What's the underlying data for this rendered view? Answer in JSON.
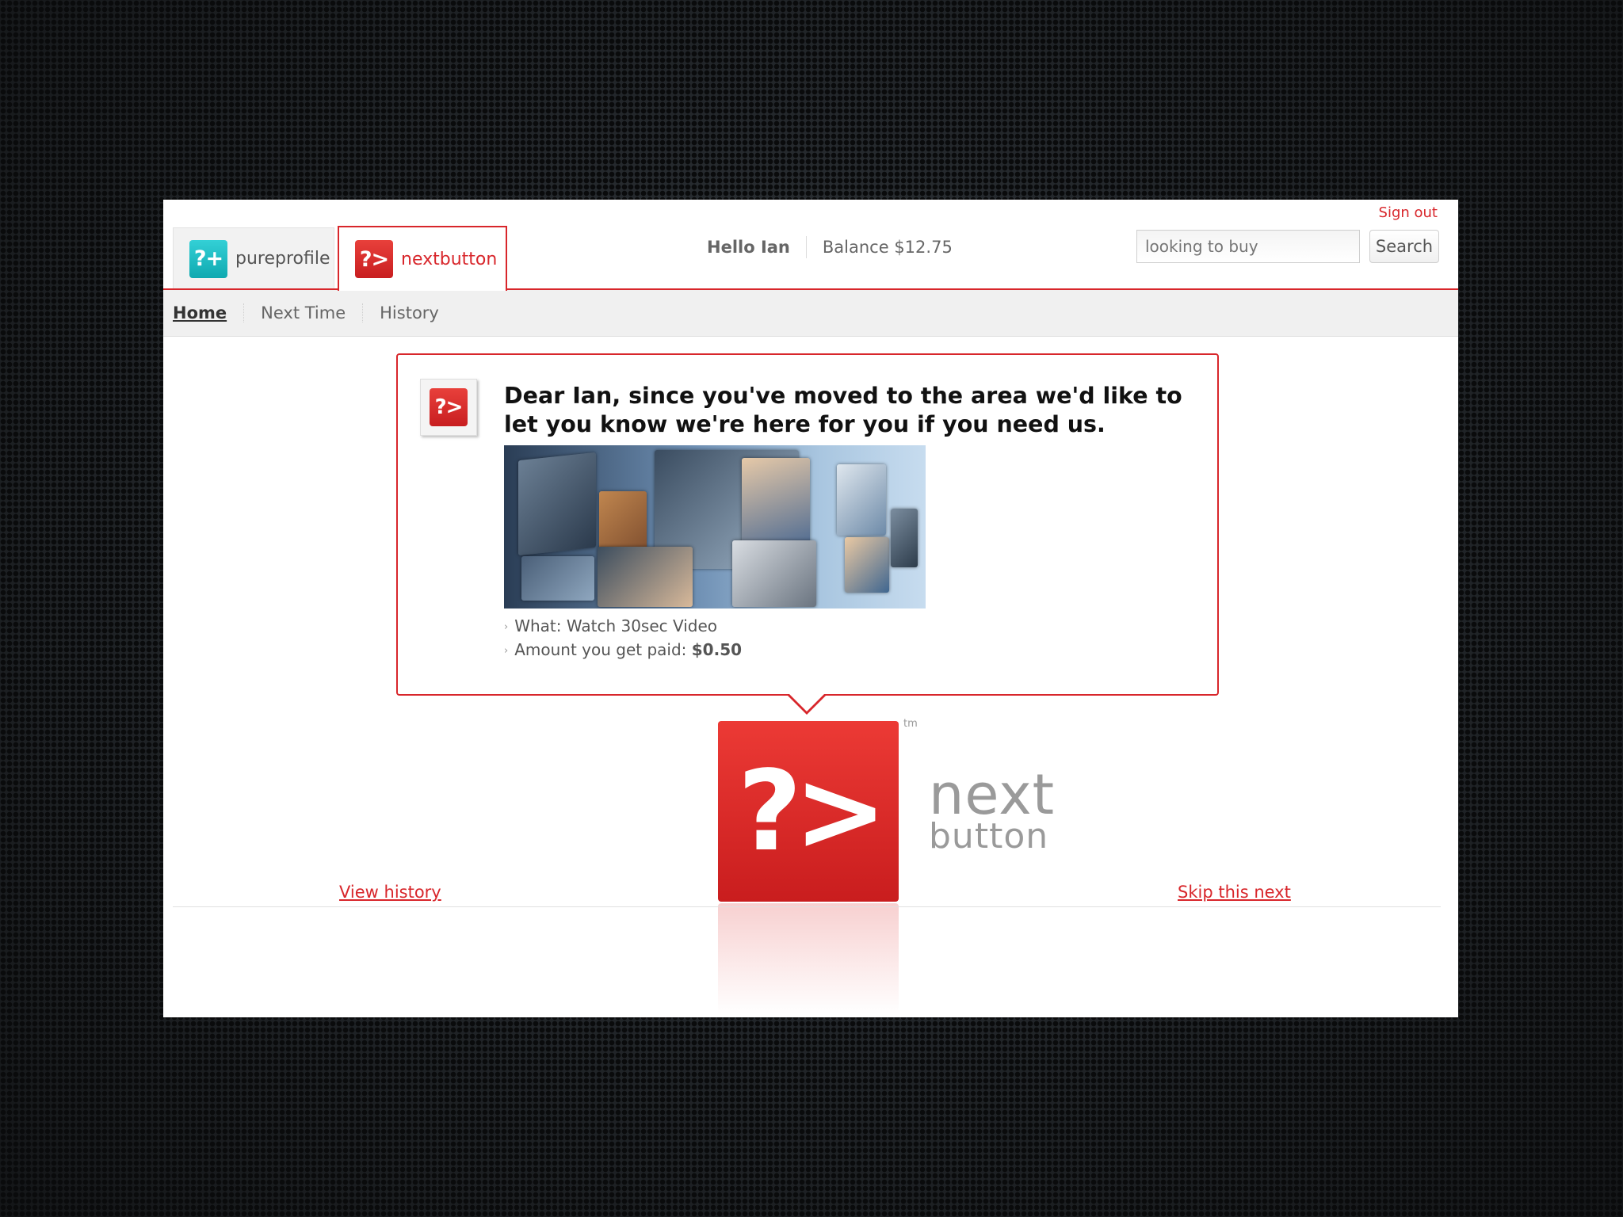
{
  "header": {
    "sign_out": "Sign out",
    "tabs": [
      {
        "label": "pureprofile",
        "icon_text": "?+",
        "icon": "pureprofile-logo-icon",
        "color": "#19b8bf",
        "active": false
      },
      {
        "label": "nextbutton",
        "icon_text": "?>",
        "icon": "nextbutton-logo-icon",
        "color": "#d8262b",
        "active": true
      }
    ],
    "greeting": "Hello Ian",
    "balance": "Balance $12.75",
    "search": {
      "placeholder": "looking to buy",
      "button_label": "Search"
    }
  },
  "nav": {
    "items": [
      {
        "label": "Home",
        "active": true
      },
      {
        "label": "Next Time",
        "active": false
      },
      {
        "label": "History",
        "active": false
      }
    ]
  },
  "card": {
    "icon_text": "?>",
    "title": "Dear Ian, since you've moved to the area we'd like to let you know we're here for you if you need us.",
    "image": "healthcare-video-collage",
    "details": {
      "what_label": "What: Watch 30sec Video",
      "amount_label": "Amount you get paid:",
      "amount_value": "$0.50"
    }
  },
  "logo": {
    "icon_text": "?>",
    "tm": "tm",
    "word1": "next",
    "word2": "button"
  },
  "footer": {
    "view_history": "View history",
    "skip": "Skip this next"
  },
  "colors": {
    "accent": "#d8262b",
    "teal": "#19b8bf",
    "background": "#1c1f22"
  }
}
